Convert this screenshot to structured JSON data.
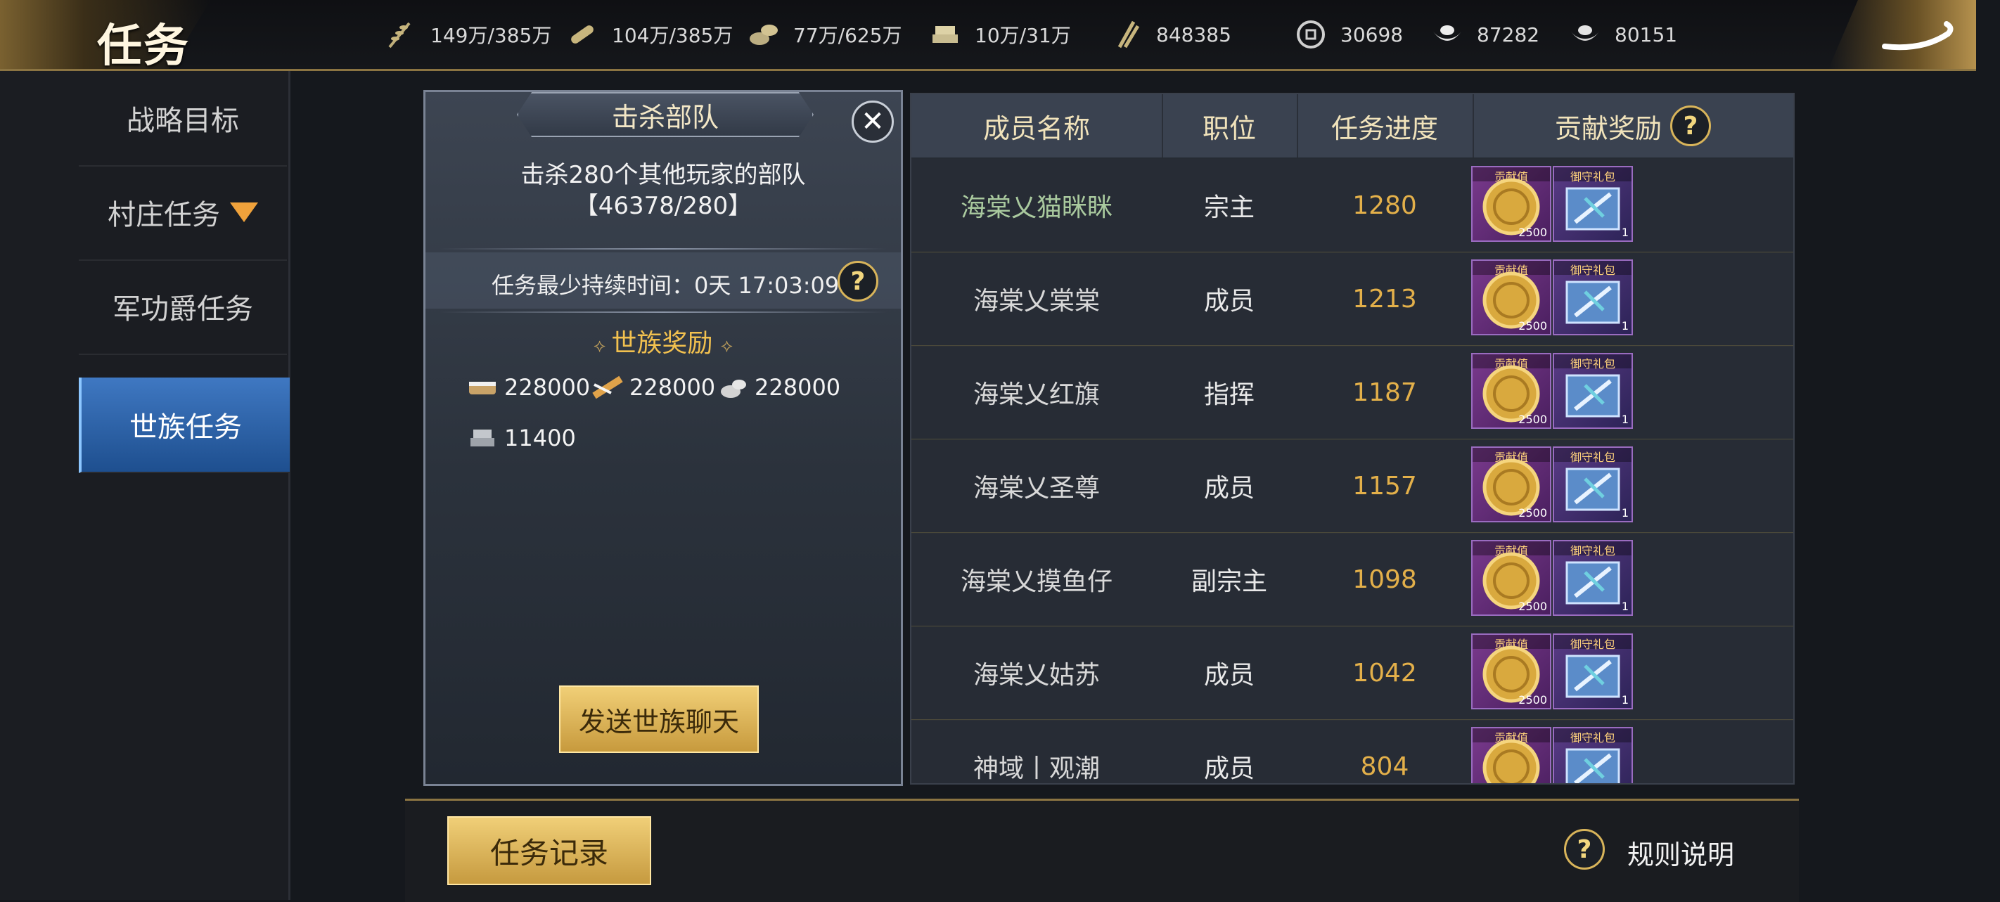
{
  "header": {
    "title": "任务",
    "resources": [
      {
        "icon": "grain-icon",
        "value": "149万/385万"
      },
      {
        "icon": "wood-icon",
        "value": "104万/385万"
      },
      {
        "icon": "stone-icon",
        "value": "77万/625万"
      },
      {
        "icon": "iron-icon",
        "value": "10万/31万"
      },
      {
        "icon": "merit-icon",
        "value": "848385"
      },
      {
        "icon": "copper-coin-icon",
        "value": "30698"
      },
      {
        "icon": "gold-ingot-icon",
        "value": "87282"
      },
      {
        "icon": "silver-ingot-icon",
        "value": "80151"
      }
    ]
  },
  "sidebar": {
    "items": [
      {
        "label": "战略目标"
      },
      {
        "label": "村庄任务"
      },
      {
        "label": "军功爵任务"
      },
      {
        "label": "世族任务"
      }
    ]
  },
  "task_panel": {
    "title": "击杀部队",
    "description": "击杀280个其他玩家的部队",
    "progress": "【46378/280】",
    "duration": "任务最少持续时间：0天 17:03:09",
    "reward_header": "世族奖励",
    "rewards": [
      "228000",
      "228000",
      "228000",
      "11400"
    ],
    "send_chat": "发送世族聊天"
  },
  "members_table": {
    "headers": [
      "成员名称",
      "职位",
      "任务进度",
      "贡献奖励"
    ],
    "reward_tags": [
      "贡献值",
      "御守礼包"
    ],
    "reward_counts": [
      "2500",
      "1"
    ],
    "rows": [
      {
        "name": "海棠乂猫眯眯",
        "role": "宗主",
        "progress": "1280"
      },
      {
        "name": "海棠乂棠棠",
        "role": "成员",
        "progress": "1213"
      },
      {
        "name": "海棠乂红旗",
        "role": "指挥",
        "progress": "1187"
      },
      {
        "name": "海棠乂圣尊",
        "role": "成员",
        "progress": "1157"
      },
      {
        "name": "海棠乂摸鱼仔",
        "role": "副宗主",
        "progress": "1098"
      },
      {
        "name": "海棠乂姑苏",
        "role": "成员",
        "progress": "1042"
      },
      {
        "name": "神域丨观潮",
        "role": "成员",
        "progress": "804"
      }
    ]
  },
  "footer": {
    "task_log": "任务记录",
    "rules": "规则说明",
    "help_glyph": "?"
  },
  "colors": {
    "accent_gold": "#e3b04a",
    "active_tab": "#3f78c2",
    "leader_name": "#a9c99e"
  }
}
